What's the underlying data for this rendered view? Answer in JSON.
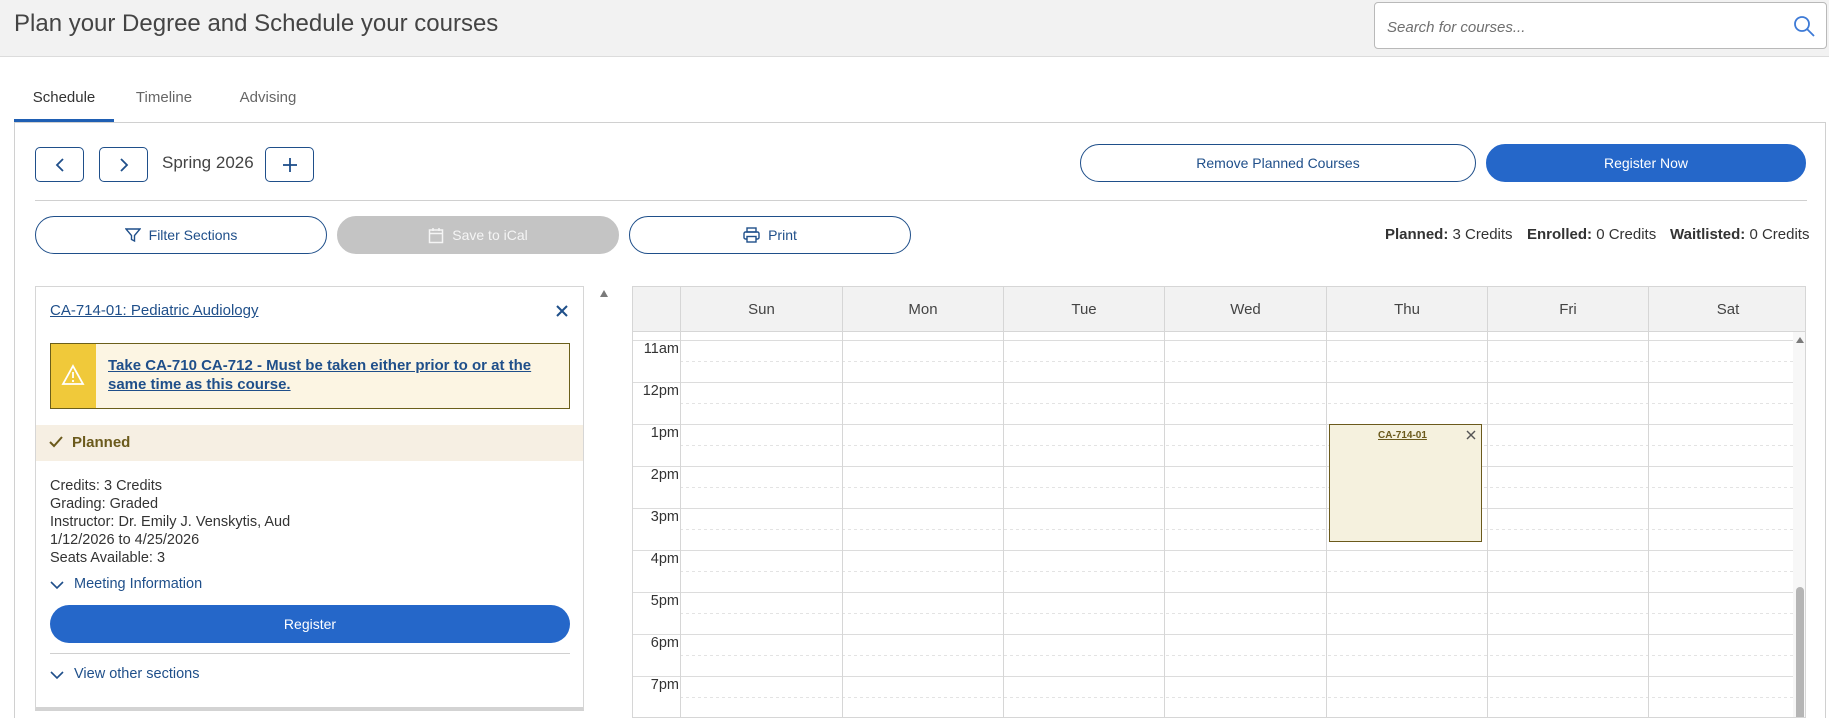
{
  "header": {
    "title": "Plan your Degree and Schedule your courses",
    "search_placeholder": "Search for courses..."
  },
  "tabs": [
    {
      "label": "Schedule",
      "active": true
    },
    {
      "label": "Timeline",
      "active": false
    },
    {
      "label": "Advising",
      "active": false
    }
  ],
  "toolbar": {
    "term": "Spring 2026",
    "remove_planned": "Remove Planned Courses",
    "register_now": "Register Now",
    "filter_sections": "Filter Sections",
    "save_ical": "Save to iCal",
    "print": "Print"
  },
  "credits": {
    "planned_label": "Planned:",
    "planned_value": "3 Credits",
    "enrolled_label": "Enrolled:",
    "enrolled_value": "0 Credits",
    "waitlisted_label": "Waitlisted:",
    "waitlisted_value": "0 Credits"
  },
  "course": {
    "title": "CA-714-01: Pediatric Audiology",
    "warning": "Take CA-710 CA-712 - Must be taken either prior to or at the same time as this course.",
    "status": "Planned",
    "credits": "Credits: 3 Credits",
    "grading": "Grading: Graded",
    "instructor": "Instructor: Dr. Emily J. Venskytis, Aud",
    "dates": "1/12/2026 to 4/25/2026",
    "seats": "Seats Available:  3",
    "meeting_info": "Meeting Information",
    "register": "Register",
    "other_sections": "View other sections"
  },
  "calendar": {
    "days": [
      "Sun",
      "Mon",
      "Tue",
      "Wed",
      "Thu",
      "Fri",
      "Sat"
    ],
    "times": [
      "11am",
      "12pm",
      "1pm",
      "2pm",
      "3pm",
      "4pm",
      "5pm",
      "6pm",
      "7pm"
    ],
    "event": {
      "label": "CA-714-01",
      "day": "Thu",
      "start": "1pm",
      "end": "3:45pm"
    }
  },
  "colors": {
    "primary": "#2567c9",
    "outline": "#1f4f8a",
    "planned_bg": "#f5f1de",
    "warning_yellow": "#f0c93a"
  }
}
